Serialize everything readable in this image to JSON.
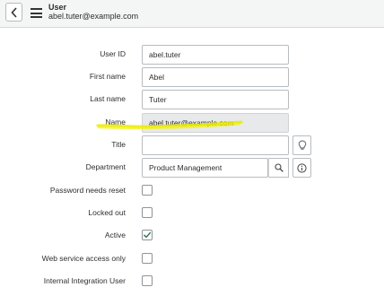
{
  "header": {
    "title": "User",
    "subtitle": "abel.tuter@example.com"
  },
  "form": {
    "user_id": {
      "label": "User ID",
      "value": "abel.tuter"
    },
    "first_name": {
      "label": "First name",
      "value": "Abel"
    },
    "last_name": {
      "label": "Last name",
      "value": "Tuter"
    },
    "name": {
      "label": "Name",
      "value": "abel.tuter@example.com"
    },
    "title": {
      "label": "Title",
      "value": ""
    },
    "department": {
      "label": "Department",
      "value": "Product Management"
    },
    "password_needs_reset": {
      "label": "Password needs reset",
      "checked": false
    },
    "locked_out": {
      "label": "Locked out",
      "checked": false
    },
    "active": {
      "label": "Active",
      "checked": true
    },
    "web_service_access_only": {
      "label": "Web service access only",
      "checked": false
    },
    "internal_integration_user": {
      "label": "Internal Integration User",
      "checked": false
    }
  },
  "colors": {
    "highlight": "#f2f200",
    "checkmark": "#2f6f5a"
  }
}
